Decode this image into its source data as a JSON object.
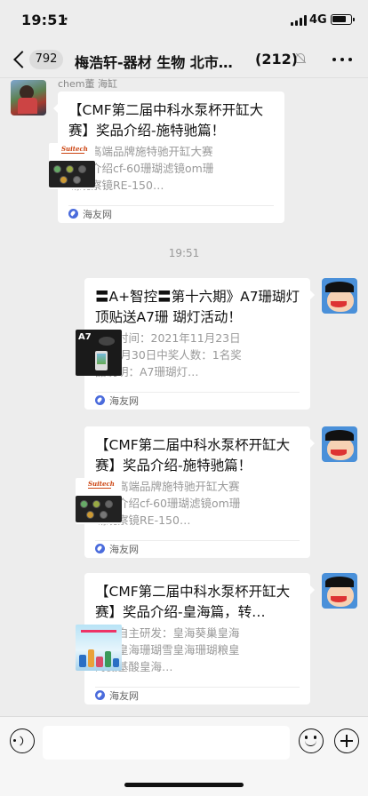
{
  "status": {
    "time": "19:51",
    "location_icon": "location-arrow-icon",
    "network": "4G",
    "signal_icon": "cellular-signal-icon",
    "battery_icon": "battery-icon"
  },
  "header": {
    "unread_count": "792",
    "title": "梅浩轩-器材 生物 北市…",
    "member_count": "(212)",
    "mute_icon": "mute-bell-icon",
    "more_icon": "more-dots-icon"
  },
  "messages": [
    {
      "sender": "chem董 海缸",
      "side": "left",
      "title": "【CMF第二届中科水泵杯开缸大赛】奖品介绍-施特驰篇！",
      "description": "国产高端品牌施特驰开缸大赛奖品介绍cf-60珊瑚滤镜om珊瑚观察镜RE-150…",
      "thumb_brand": "Suitech",
      "source": "海友网"
    },
    {
      "timestamp": "19:51"
    },
    {
      "side": "right",
      "title": "〓A+智控〓第十六期》A7珊瑚灯顶贴送A7珊 瑚灯活动！",
      "description": "活动时间：2021年11月23日到11月30日中奖人数：1名奖品说明：A7珊瑚灯…",
      "thumb_label": "A7",
      "source": "海友网"
    },
    {
      "side": "right",
      "title": "【CMF第二届中科水泵杯开缸大赛】奖品介绍-施特驰篇！",
      "description": "国产高端品牌施特驰开缸大赛奖品介绍cf-60珊瑚滤镜om珊瑚观察镜RE-150…",
      "thumb_brand": "Suitech",
      "source": "海友网"
    },
    {
      "side": "right",
      "title": "【CMF第二届中科水泵杯开缸大赛】奖品介绍-皇海篇，转…",
      "description": "皇海自主研发：皇海葵巢皇海滤镜皇海珊瑚雪皇海珊瑚粮皇海氨基酸皇海…",
      "source": "海友网"
    }
  ],
  "input_bar": {
    "voice_icon": "voice-icon",
    "text_value": "",
    "emoji_icon": "emoji-icon",
    "plus_icon": "plus-icon"
  },
  "colors": {
    "background": "#ededed",
    "card": "#ffffff",
    "text_primary": "#111111",
    "text_secondary": "#999999",
    "source_icon": "#4a6bdc"
  }
}
